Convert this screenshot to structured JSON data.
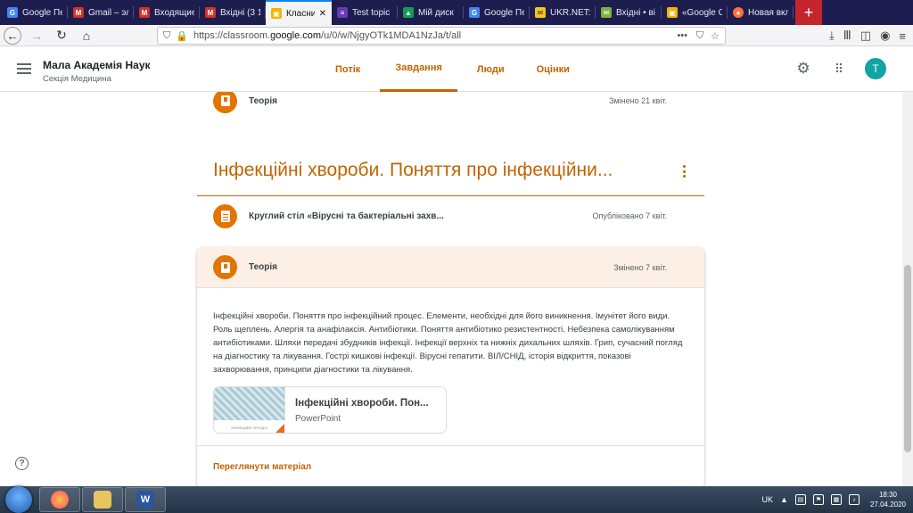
{
  "browser": {
    "tabs": [
      {
        "label": "Google Пе",
        "fav": "google-docs-icon",
        "color": "#4285f4",
        "glyph": "G"
      },
      {
        "label": "Gmail – эл",
        "fav": "gmail-icon",
        "color": "#d93025",
        "glyph": "M"
      },
      {
        "label": "Входящие",
        "fav": "gmail-icon",
        "color": "#d93025",
        "glyph": "M"
      },
      {
        "label": "Вхідні (3 1",
        "fav": "gmail-icon",
        "color": "#d93025",
        "glyph": "M"
      },
      {
        "label": "Класни",
        "fav": "classroom-icon",
        "color": "#f4b400",
        "glyph": "▣",
        "active": true
      },
      {
        "label": "Test topic",
        "fav": "forms-icon",
        "color": "#673ab7",
        "glyph": "≡"
      },
      {
        "label": "Мій диск",
        "fav": "drive-icon",
        "color": "#0f9d58",
        "glyph": "▲"
      },
      {
        "label": "Google Пе",
        "fav": "google-docs-icon",
        "color": "#4285f4",
        "glyph": "G"
      },
      {
        "label": "UKR.NET:",
        "fav": "ukrnet-icon",
        "color": "#f5c518",
        "glyph": "✉"
      },
      {
        "label": "Вхідні • ві",
        "fav": "mail-icon",
        "color": "#7cb342",
        "glyph": "✉"
      },
      {
        "label": "«Google С",
        "fav": "google-docs-icon",
        "color": "#f4b400",
        "glyph": "▣"
      },
      {
        "label": "Новая вкл",
        "fav": "firefox-icon",
        "color": "#ff7139",
        "glyph": "●"
      }
    ],
    "new_tab": "+",
    "url_prefix": "https://classroom.",
    "url_domain": "google.com",
    "url_path": "/u/0/w/NjgyOTk1MDA1NzJa/t/all"
  },
  "app": {
    "class_name": "Мала Академія Наук",
    "section": "Секція Медицина",
    "nav_tabs": [
      {
        "label": "Потік"
      },
      {
        "label": "Завдання",
        "selected": true
      },
      {
        "label": "Люди"
      },
      {
        "label": "Оцінки"
      }
    ],
    "avatar_letter": "T"
  },
  "content": {
    "prev_item": {
      "title": "Теорія",
      "date": "Змінено 21 квіт."
    },
    "topic_title": "Інфекційні хвороби. Поняття про інфекційни...",
    "item1": {
      "title": "Круглий стіл «Вірусні та бактеріальні захв...",
      "date": "Опубліковано 7 квіт."
    },
    "card": {
      "title": "Теорія",
      "date": "Змінено 7 квіт.",
      "description": "Інфекційні хвороби. Поняття про інфекційний процес. Елементи, необхідні для його виникнення. Імунітет його види. Роль щеплень. Алергія та анафілаксія. Антибіотики. Поняття антибіотико резистентності. Небезпека самолікуванням антибіотиками. Шляхи передачі збудників інфекції. Інфекції верхніх та нижніх дихальних шляхів. Грип, сучасний погляд на діагностику та лікування. Гострі кишкові інфекції. Вірусні гепатити. ВІЛ/СНІД, історія відкриття, показові захворювання, принципи діагностики та лікування.",
      "attachment": {
        "title": "Інфекційні хвороби. Пон...",
        "type": "PowerPoint",
        "thumb_text": "ІНФЕКЦІЙНІ ПРОЦЕС"
      },
      "view_link": "Переглянути матеріал"
    },
    "help": "?"
  },
  "taskbar": {
    "lang": "UK",
    "time": "18:30",
    "date": "27.04.2020"
  },
  "colors": {
    "accent": "#c26401",
    "badge": "#e37400",
    "card_header": "#fcefe5",
    "avatar": "#12a3a3"
  }
}
